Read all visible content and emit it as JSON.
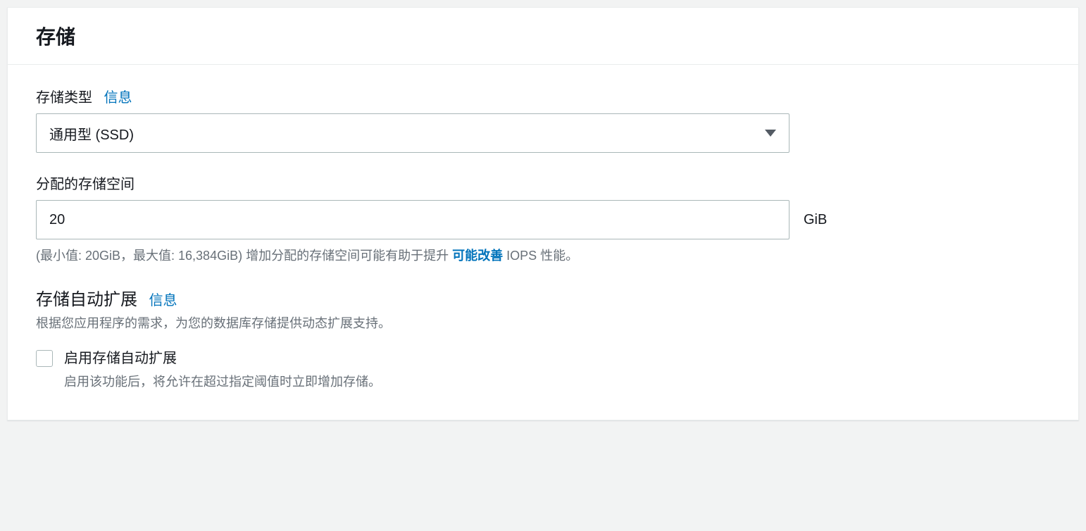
{
  "panel": {
    "title": "存储"
  },
  "storageType": {
    "label": "存储类型",
    "infoLink": "信息",
    "selected": "通用型 (SSD)"
  },
  "allocatedStorage": {
    "label": "分配的存储空间",
    "value": "20",
    "unit": "GiB",
    "hintPrefix": "(最小值: 20GiB，最大值: 16,384GiB) 增加分配的存储空间可能有助于提升 ",
    "hintLink": "可能改善",
    "hintSuffix": " IOPS 性能。"
  },
  "autoscaling": {
    "title": "存储自动扩展",
    "infoLink": "信息",
    "description": "根据您应用程序的需求，为您的数据库存储提供动态扩展支持。",
    "checkbox": {
      "label": "启用存储自动扩展",
      "description": "启用该功能后，将允许在超过指定阈值时立即增加存储。"
    }
  }
}
